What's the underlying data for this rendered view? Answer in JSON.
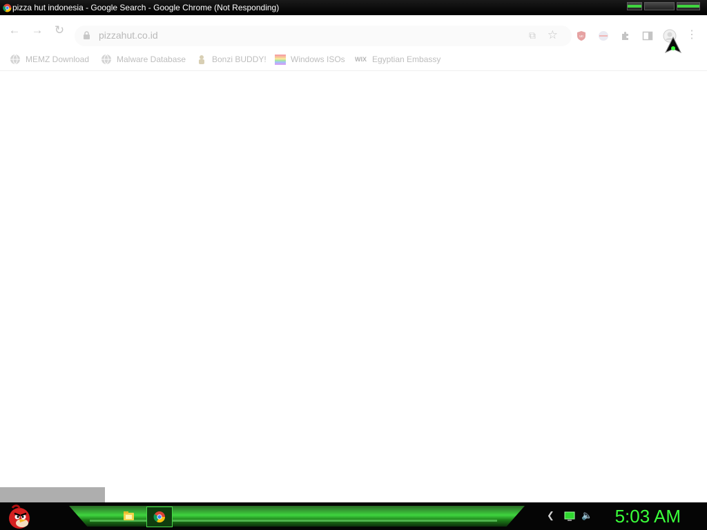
{
  "window": {
    "title": "pizza hut indonesia - Google Search - Google Chrome (Not Responding)"
  },
  "toolbar": {
    "back_icon": "back-arrow-icon",
    "forward_icon": "forward-arrow-icon",
    "reload_icon": "reload-icon",
    "url": "pizzahut.co.id",
    "share_icon": "share-icon",
    "bookmark_star_icon": "star-icon",
    "extensions": [
      "ublock-origin-icon",
      "extension-icon",
      "puzzle-extensions-icon",
      "side-panel-icon",
      "profile-avatar-icon"
    ],
    "menu_icon": "kebab-menu-icon"
  },
  "bookmarks": [
    {
      "label": "MEMZ Download",
      "icon": "globe-icon"
    },
    {
      "label": "Malware Database",
      "icon": "globe-icon"
    },
    {
      "label": "Bonzi BUDDY!",
      "icon": "bonzi-icon"
    },
    {
      "label": "Windows ISOs",
      "icon": "rainbow-icon"
    },
    {
      "label": "Egyptian Embassy",
      "icon": "wix-icon"
    }
  ],
  "wix_text": "WIX",
  "taskbar": {
    "start_icon": "angry-bird-start-icon",
    "apps": [
      "file-explorer-icon",
      "chrome-icon"
    ],
    "tray": [
      "chevron-left-icon",
      "network-monitor-icon",
      "volume-icon"
    ],
    "clock": "5:03 AM"
  },
  "colors": {
    "accent_green": "#3fd43f",
    "clock_green": "#3aff3a",
    "titlebar_bg": "#000000",
    "status_bubble": "#aeaeae"
  }
}
